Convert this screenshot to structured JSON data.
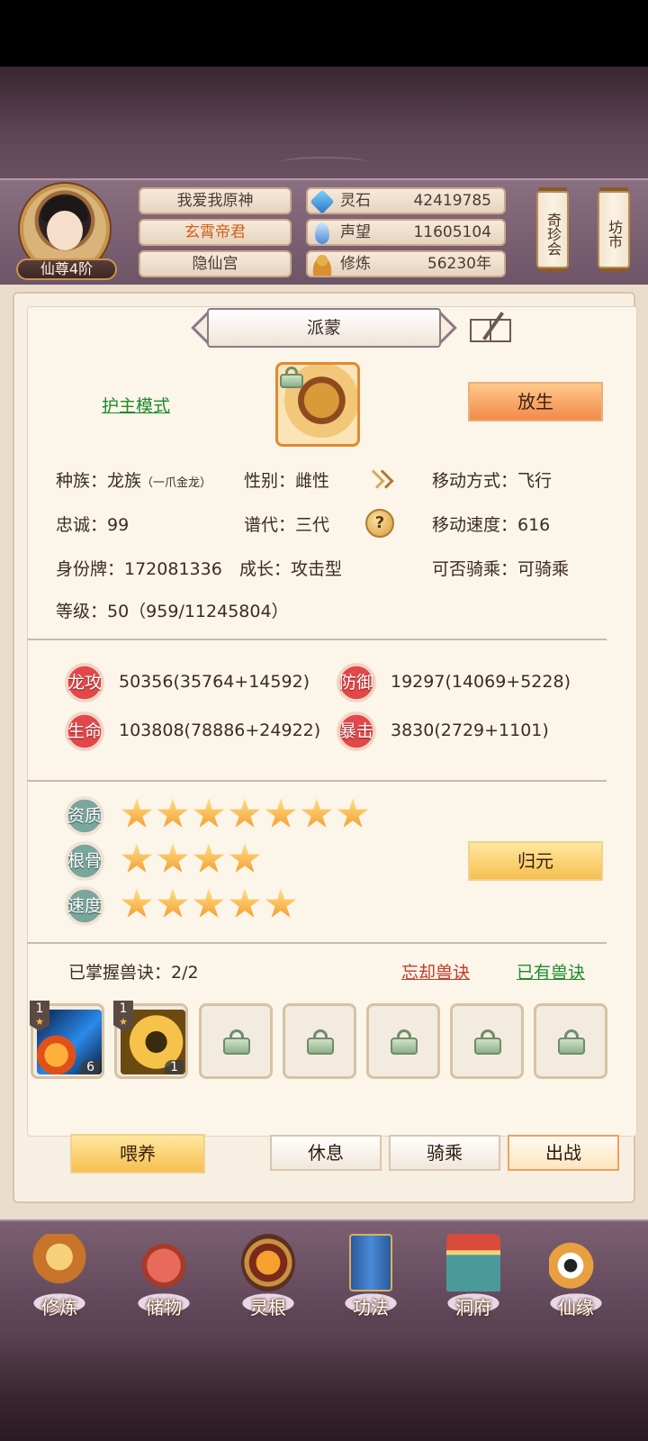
{
  "header": {
    "rank": "仙尊4阶",
    "names": [
      "我爱我原神",
      "玄霄帝君",
      "隐仙宫"
    ],
    "resources": [
      {
        "icon": "spirit-stone-icon",
        "label": "灵石",
        "value": "42419785"
      },
      {
        "icon": "reputation-icon",
        "label": "声望",
        "value": "11605104"
      },
      {
        "icon": "cultivation-icon",
        "label": "修炼",
        "value": "56230年"
      }
    ],
    "side_buttons": [
      "奇珍会",
      "坊市"
    ]
  },
  "pet": {
    "name": "派蒙",
    "mode_link": "护主模式",
    "release_button": "放生",
    "attrs": {
      "race_label": "种族：龙族",
      "race_sub": "（一爪金龙）",
      "gender": "性别：雌性",
      "move_type": "移动方式：飞行",
      "loyalty": "忠诚：99",
      "generation": "谱代：三代",
      "move_speed": "移动速度：616",
      "id_tag": "身份牌：172081336",
      "growth": "成长：攻击型",
      "rideable": "可否骑乘：可骑乘",
      "level": "等级：50（959/11245804）"
    },
    "stats": [
      {
        "label": "龙攻",
        "value": "50356(35764+14592)"
      },
      {
        "label": "防御",
        "value": "19297(14069+5228)"
      },
      {
        "label": "生命",
        "value": "103808(78886+24922)"
      },
      {
        "label": "暴击",
        "value": "3830(2729+1101)"
      }
    ],
    "qualities": [
      {
        "label": "资质",
        "stars": 7
      },
      {
        "label": "根骨",
        "stars": 4
      },
      {
        "label": "速度",
        "stars": 5
      }
    ],
    "reset_button": "归元",
    "skills": {
      "mastered": "已掌握兽诀：2/2",
      "forget_link": "忘却兽诀",
      "owned_link": "已有兽诀",
      "slots": [
        {
          "level": "1",
          "count": "6"
        },
        {
          "level": "1",
          "count": "1"
        }
      ]
    }
  },
  "actions": {
    "feed": "喂养",
    "rest": "休息",
    "ride": "骑乘",
    "battle": "出战"
  },
  "nav": [
    "修炼",
    "储物",
    "灵根",
    "功法",
    "洞府",
    "仙缘"
  ],
  "colors": {
    "accent_orange": "#f28a4a",
    "gold": "#f6c050",
    "link_green": "#1f8a2a",
    "link_red": "#c23a2a",
    "stat_red": "#e2474a",
    "stat_teal": "#7aa69c"
  }
}
